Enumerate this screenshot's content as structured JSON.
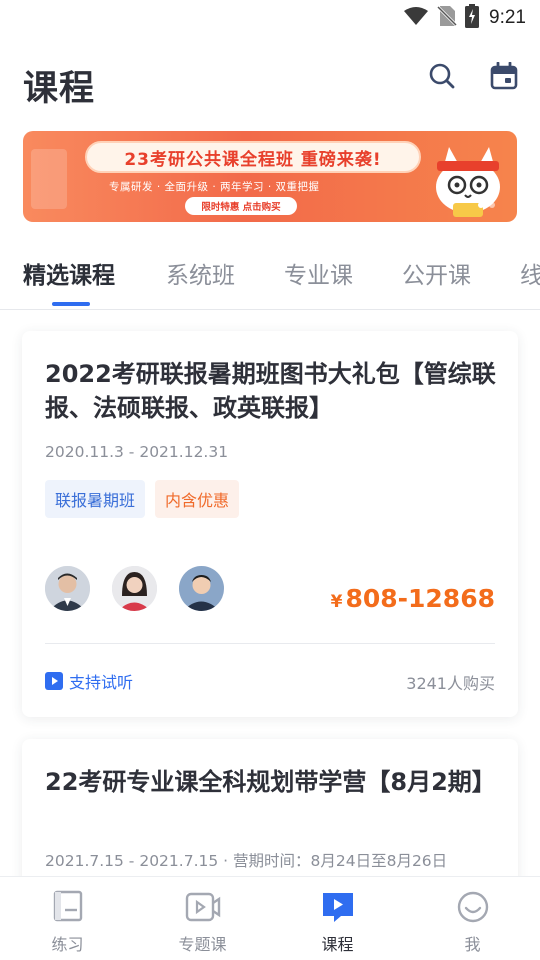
{
  "status_bar": {
    "time": "9:21"
  },
  "header": {
    "title": "课程"
  },
  "banner": {
    "headline": "23考研公共课全程班 重磅来袭!",
    "subline": "专属研发 · 全面升级 · 两年学习 · 双重把握",
    "cta": "限时特惠 点击购买",
    "slide_count": 2,
    "active_slide": 1
  },
  "tabs": [
    {
      "label": "精选课程",
      "active": true
    },
    {
      "label": "系统班",
      "active": false
    },
    {
      "label": "专业课",
      "active": false
    },
    {
      "label": "公开课",
      "active": false
    },
    {
      "label": "线",
      "active": false
    }
  ],
  "courses": [
    {
      "title": "2022考研联报暑期班图书大礼包【管综联报、法硕联报、政英联报】",
      "date": "2020.11.3 - 2021.12.31",
      "tags": [
        "联报暑期班",
        "内含优惠"
      ],
      "teachers": [
        "teacher-1",
        "teacher-2",
        "teacher-3"
      ],
      "price_currency": "¥",
      "price": "808-12868",
      "trial_label": "支持试听",
      "buyers": "3241人购买"
    },
    {
      "title": "22考研专业课全科规划带学营【8月2期】",
      "date": "2021.7.15 - 2021.7.15 · 营期时间：8月24日至8月26日"
    }
  ],
  "bottom_nav": [
    {
      "label": "练习",
      "icon": "book-icon",
      "active": false
    },
    {
      "label": "专题课",
      "icon": "video-icon",
      "active": false
    },
    {
      "label": "课程",
      "icon": "play-flag-icon",
      "active": true
    },
    {
      "label": "我",
      "icon": "smile-icon",
      "active": false
    }
  ],
  "colors": {
    "accent": "#2f6df0",
    "price": "#f36c1b",
    "banner": "#f26a4a"
  }
}
